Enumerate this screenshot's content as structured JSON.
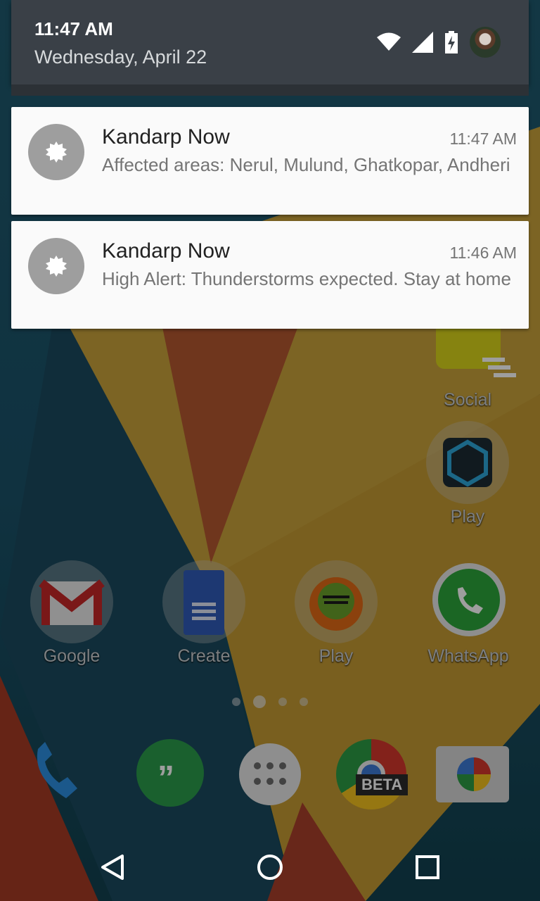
{
  "status": {
    "time": "11:47 AM",
    "date": "Wednesday, April 22",
    "icons": [
      "wifi-icon",
      "signal-icon",
      "battery-charging-icon",
      "user-avatar"
    ]
  },
  "notifications": [
    {
      "app": "Kandarp Now",
      "time": "11:47 AM",
      "text": "Affected areas: Nerul, Mulund, Ghatkopar, Andheri"
    },
    {
      "app": "Kandarp Now",
      "time": "11:46 AM",
      "text": "High Alert: Thunderstorms expected. Stay at home"
    }
  ],
  "home": {
    "folders": [
      {
        "label": "Social"
      },
      {
        "label": "Play"
      }
    ],
    "row": [
      {
        "label": "Google"
      },
      {
        "label": "Create"
      },
      {
        "label": "Play"
      },
      {
        "label": "WhatsApp"
      }
    ],
    "page_indicator": {
      "count": 4,
      "active": 1
    },
    "dock": [
      "phone-icon",
      "hangouts-icon",
      "app-drawer-icon",
      "chrome-beta-icon",
      "camera-icon"
    ],
    "chrome_badge": "BETA"
  },
  "navigation": [
    "back-button",
    "home-button",
    "recents-button"
  ],
  "colors": {
    "header_bg": "#3a4047",
    "notification_bg": "#fafafa",
    "notification_icon_bg": "#9e9e9e"
  }
}
